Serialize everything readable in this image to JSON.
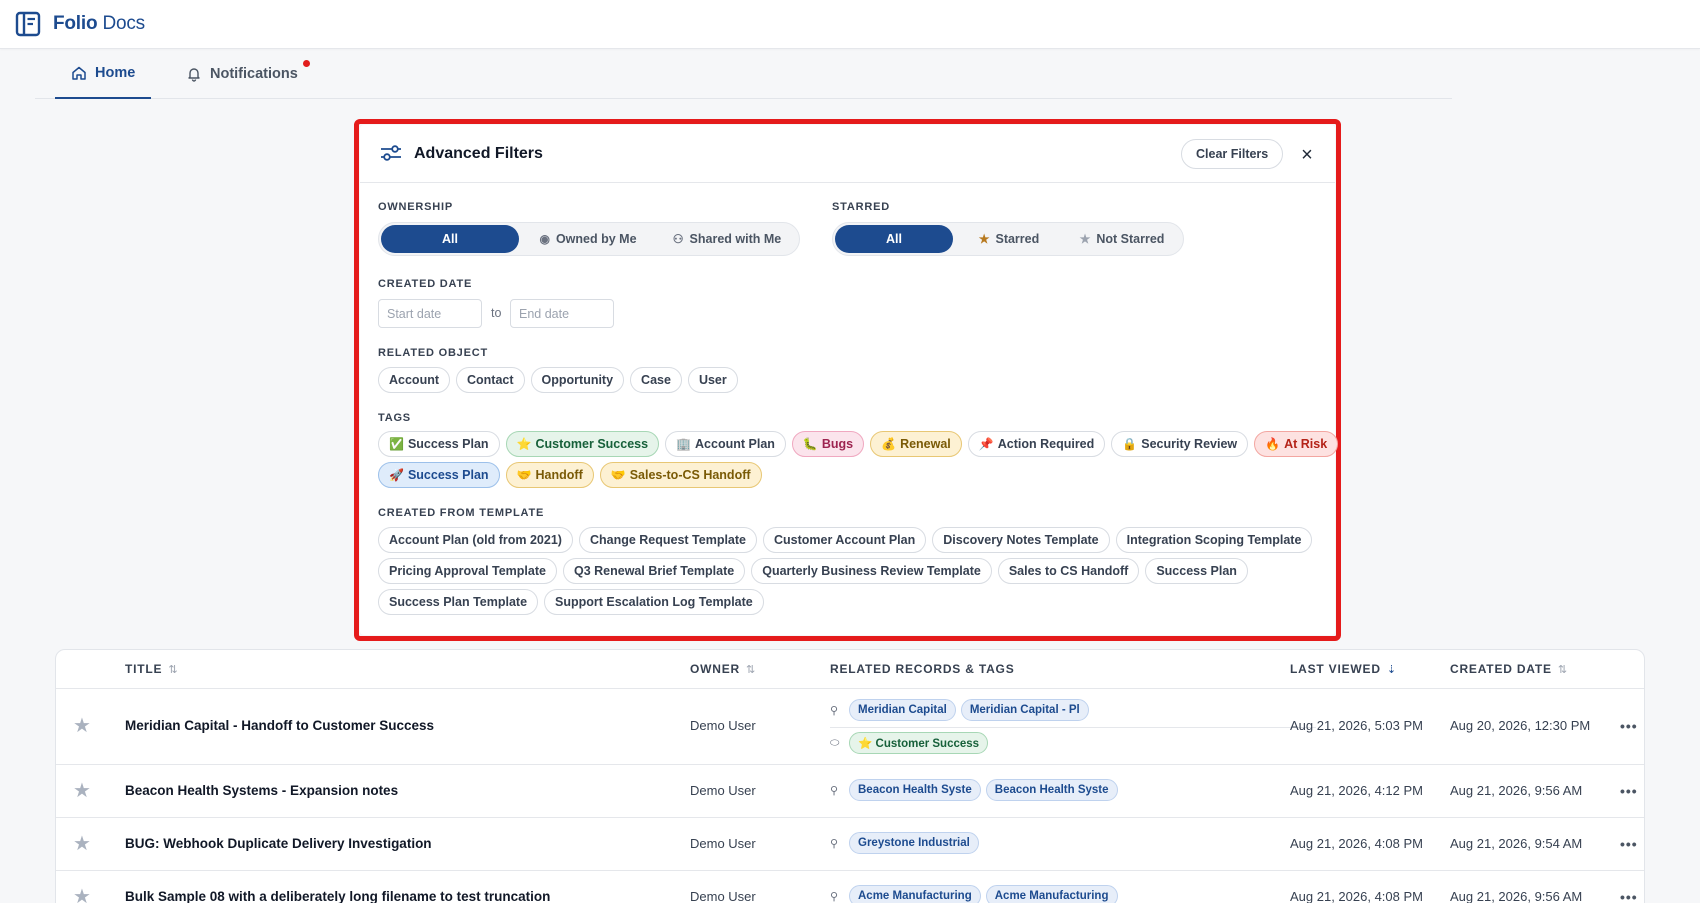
{
  "app": {
    "name_bold": "Folio",
    "name_light": "Docs"
  },
  "nav": {
    "home": "Home",
    "notifications": "Notifications"
  },
  "filters": {
    "title": "Advanced Filters",
    "clear": "Clear Filters",
    "close": "×",
    "ownership": {
      "label": "OWNERSHIP",
      "options": [
        "All",
        "Owned by Me",
        "Shared with Me"
      ],
      "selected": "All"
    },
    "starred": {
      "label": "STARRED",
      "options": [
        "All",
        "Starred",
        "Not Starred"
      ],
      "selected": "All"
    },
    "created_date": {
      "label": "CREATED DATE",
      "start_placeholder": "Start date",
      "to": "to",
      "end_placeholder": "End date"
    },
    "related_object": {
      "label": "RELATED OBJECT",
      "options": [
        "Account",
        "Contact",
        "Opportunity",
        "Case",
        "User"
      ]
    },
    "tags": {
      "label": "TAGS",
      "row1": [
        {
          "emoji": "✅",
          "text": "Success Plan",
          "style": "plain"
        },
        {
          "emoji": "⭐",
          "text": "Customer Success",
          "style": "green"
        },
        {
          "emoji": "🏢",
          "text": "Account Plan",
          "style": "plain"
        },
        {
          "emoji": "🐛",
          "text": "Bugs",
          "style": "pink"
        },
        {
          "emoji": "💰",
          "text": "Renewal",
          "style": "amber"
        },
        {
          "emoji": "📌",
          "text": "Action Required",
          "style": "plain"
        },
        {
          "emoji": "🔒",
          "text": "Security Review",
          "style": "plain"
        },
        {
          "emoji": "🔥",
          "text": "At Risk",
          "style": "red"
        }
      ],
      "row2": [
        {
          "emoji": "🚀",
          "text": "Success Plan",
          "style": "blue"
        },
        {
          "emoji": "🤝",
          "text": "Handoff",
          "style": "amber"
        },
        {
          "emoji": "🤝",
          "text": "Sales-to-CS Handoff",
          "style": "amber"
        }
      ]
    },
    "templates": {
      "label": "CREATED FROM TEMPLATE",
      "row1": [
        "Account Plan (old from 2021)",
        "Change Request Template",
        "Customer Account Plan",
        "Discovery Notes Template",
        "Integration Scoping Template"
      ],
      "row2": [
        "Pricing Approval Template",
        "Q3 Renewal Brief Template",
        "Quarterly Business Review Template",
        "Sales to CS Handoff",
        "Success Plan"
      ],
      "row3": [
        "Success Plan Template",
        "Support Escalation Log Template"
      ]
    }
  },
  "table": {
    "headers": {
      "title": "TITLE",
      "owner": "OWNER",
      "related": "RELATED RECORDS & TAGS",
      "last_viewed": "LAST VIEWED",
      "created": "CREATED DATE"
    },
    "rows": [
      {
        "title": "Meridian Capital - Handoff to Customer Success",
        "owner": "Demo User",
        "records": [
          "Meridian Capital",
          "Meridian Capital - Pl"
        ],
        "tags": [
          "⭐ Customer Success"
        ],
        "last_viewed": "Aug 21, 2026, 5:03 PM",
        "created": "Aug 20, 2026, 12:30 PM"
      },
      {
        "title": "Beacon Health Systems - Expansion notes",
        "owner": "Demo User",
        "records": [
          "Beacon Health Syste",
          "Beacon Health Syste"
        ],
        "last_viewed": "Aug 21, 2026, 4:12 PM",
        "created": "Aug 21, 2026, 9:56 AM"
      },
      {
        "title": "BUG: Webhook Duplicate Delivery Investigation",
        "owner": "Demo User",
        "records": [
          "Greystone Industrial"
        ],
        "last_viewed": "Aug 21, 2026, 4:08 PM",
        "created": "Aug 21, 2026, 9:54 AM"
      },
      {
        "title": "Bulk Sample 08 with a deliberately long filename to test truncation",
        "owner": "Demo User",
        "records": [
          "Acme Manufacturing",
          "Acme Manufacturing"
        ],
        "last_viewed": "Aug 21, 2026, 4:08 PM",
        "created": "Aug 21, 2026, 9:56 AM"
      }
    ],
    "more": "•••"
  },
  "colors": {
    "brand": "#1d4b8f",
    "highlight": "#e51b1b",
    "notification": "#e11d1d"
  },
  "icons": [
    "logo-icon",
    "home-icon",
    "bell-icon",
    "filter-sliders-icon",
    "close-icon",
    "user-circle-icon",
    "shared-users-icon",
    "star-icon",
    "link-icon",
    "tag-icon",
    "sort-icon",
    "more-icon"
  ]
}
